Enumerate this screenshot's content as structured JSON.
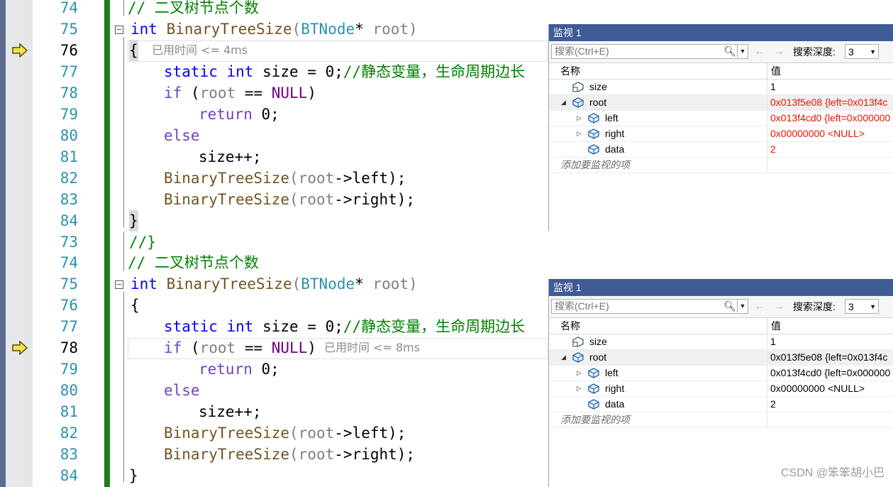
{
  "editor": {
    "top": {
      "lines": [
        {
          "num": "74",
          "comment": "// 二叉树节点个数"
        },
        {
          "num": "75",
          "kw": "int",
          "fn": "BinaryTreeSize",
          "p1": "(",
          "type": "BTNode",
          "star": "* ",
          "param": "root",
          "p2": ")"
        },
        {
          "num": "76",
          "brace": "{",
          "hint": "已用时间 <= 4ms"
        },
        {
          "num": "77",
          "kw1": "static",
          "kw2": "int",
          "ident": " size = 0;",
          "comment": "//静态变量，生命周期边长"
        },
        {
          "num": "78",
          "kw": "if",
          "a": " (",
          "param": "root",
          "b": " == ",
          "null": "NULL",
          "c": ")"
        },
        {
          "num": "79",
          "kw": "return",
          "rest": " 0;"
        },
        {
          "num": "80",
          "kw": "else"
        },
        {
          "num": "81",
          "rest": "size++;"
        },
        {
          "num": "82",
          "fn": "BinaryTreeSize",
          "p1": "(",
          "param": "root",
          "arrow": "->",
          "member": "left",
          "p2": ");"
        },
        {
          "num": "83",
          "fn": "BinaryTreeSize",
          "p1": "(",
          "param": "root",
          "arrow": "->",
          "member": "right",
          "p2": ");"
        },
        {
          "num": "84",
          "brace": "}"
        }
      ]
    },
    "bottom": {
      "lines": [
        {
          "num": "73",
          "comment": "//}"
        },
        {
          "num": "74",
          "comment": "// 二叉树节点个数"
        },
        {
          "num": "75",
          "kw": "int",
          "fn": "BinaryTreeSize",
          "p1": "(",
          "type": "BTNode",
          "star": "* ",
          "param": "root",
          "p2": ")"
        },
        {
          "num": "76",
          "brace": "{"
        },
        {
          "num": "77",
          "kw1": "static",
          "kw2": "int",
          "ident": " size = 0;",
          "comment": "//静态变量，生命周期边长"
        },
        {
          "num": "78",
          "kw": "if",
          "a": " (",
          "param": "root",
          "b": " == ",
          "null": "NULL",
          "c": ")",
          "hint": "已用时间 <= 8ms"
        },
        {
          "num": "79",
          "kw": "return",
          "rest": " 0;"
        },
        {
          "num": "80",
          "kw": "else"
        },
        {
          "num": "81",
          "rest": "size++;"
        },
        {
          "num": "82",
          "fn": "BinaryTreeSize",
          "p1": "(",
          "param": "root",
          "arrow": "->",
          "member": "left",
          "p2": ");"
        },
        {
          "num": "83",
          "fn": "BinaryTreeSize",
          "p1": "(",
          "param": "root",
          "arrow": "->",
          "member": "right",
          "p2": ");"
        },
        {
          "num": "84",
          "brace": "}"
        }
      ]
    }
  },
  "watch_top": {
    "title": "监视 1",
    "search_placeholder": "搜索(Ctrl+E)",
    "search_icon": "search-icon",
    "depth_label": "搜索深度:",
    "depth_value": "3",
    "col_name": "名称",
    "col_value": "值",
    "rows": [
      {
        "name": "size",
        "value": "1",
        "changed": false
      },
      {
        "name": "root",
        "value": "0x013f5e08 {left=0x013f4c",
        "changed": true
      },
      {
        "name": "left",
        "value": "0x013f4cd0 {left=0x000000",
        "changed": true
      },
      {
        "name": "right",
        "value": "0x00000000 <NULL>",
        "changed": true
      },
      {
        "name": "data",
        "value": "2",
        "changed": true
      }
    ],
    "add_item": "添加要监视的项"
  },
  "watch_bottom": {
    "title": "监视 1",
    "search_placeholder": "搜索(Ctrl+E)",
    "search_icon": "search-icon",
    "depth_label": "搜索深度:",
    "depth_value": "3",
    "col_name": "名称",
    "col_value": "值",
    "rows": [
      {
        "name": "size",
        "value": "1",
        "changed": false
      },
      {
        "name": "root",
        "value": "0x013f5e08 {left=0x013f4c",
        "changed": false
      },
      {
        "name": "left",
        "value": "0x013f4cd0 {left=0x000000",
        "changed": false
      },
      {
        "name": "right",
        "value": "0x00000000 <NULL>",
        "changed": false
      },
      {
        "name": "data",
        "value": "2",
        "changed": false
      }
    ],
    "add_item": "添加要监视的项"
  },
  "colors": {
    "changed_value": "#e51400",
    "title_bar": "#3f5b96",
    "line_number": "#2b91af"
  },
  "watermark": "CSDN @笨笨胡小巴"
}
